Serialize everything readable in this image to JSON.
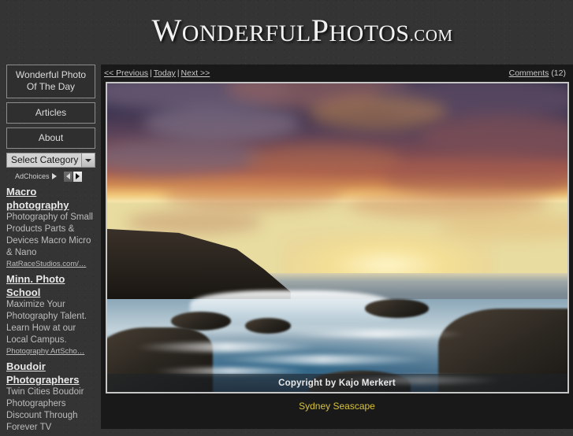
{
  "header": {
    "title_parts": {
      "w": "W",
      "onderful": "ONDERFUL",
      "p": "P",
      "hotos": "HOTOS",
      "tld": ".COM"
    },
    "title_full": "WonderfulPhotos.com"
  },
  "sidebar": {
    "menu": [
      {
        "label": "Wonderful Photo Of The Day",
        "line1": "Wonderful Photo",
        "line2": "Of The Day"
      },
      {
        "label": "Articles"
      },
      {
        "label": "About"
      }
    ],
    "category_select": {
      "selected": "Select Category",
      "icon": "chevron-down-icon"
    },
    "adchoices": {
      "label": "AdChoices",
      "triangle_icon": "play-triangle-icon",
      "prev_icon": "chevron-left-icon",
      "next_icon": "chevron-right-icon"
    },
    "ads": [
      {
        "title": "Macro photography",
        "desc": "Photography of Small Products Parts & Devices Macro Micro & Nano",
        "url": "RatRaceStudios.com/…"
      },
      {
        "title": "Minn. Photo School",
        "desc": "Maximize Your Photography Talent. Learn How at our Local Campus.",
        "url": "Photography ArtScho…"
      },
      {
        "title": "Boudoir Photographers",
        "desc": "Twin Cities Boudoir Photographers Discount Through Forever TV",
        "url": ""
      }
    ]
  },
  "content": {
    "nav": {
      "previous": "<< Previous",
      "today": "Today",
      "next": "Next >>",
      "separator": "|"
    },
    "comments": {
      "link": "Comments",
      "count": "(12)"
    },
    "photo": {
      "copyright": "Copyright by Kajo Merkert",
      "caption": "Sydney Seascape",
      "alt": "Sunset seascape with rocky coastline and flowing water"
    }
  },
  "colors": {
    "page_bg": "#343434",
    "content_bg": "#191919",
    "caption": "#d8c33a",
    "frame_border": "#c6c6c6",
    "text": "#d6d6d6"
  }
}
